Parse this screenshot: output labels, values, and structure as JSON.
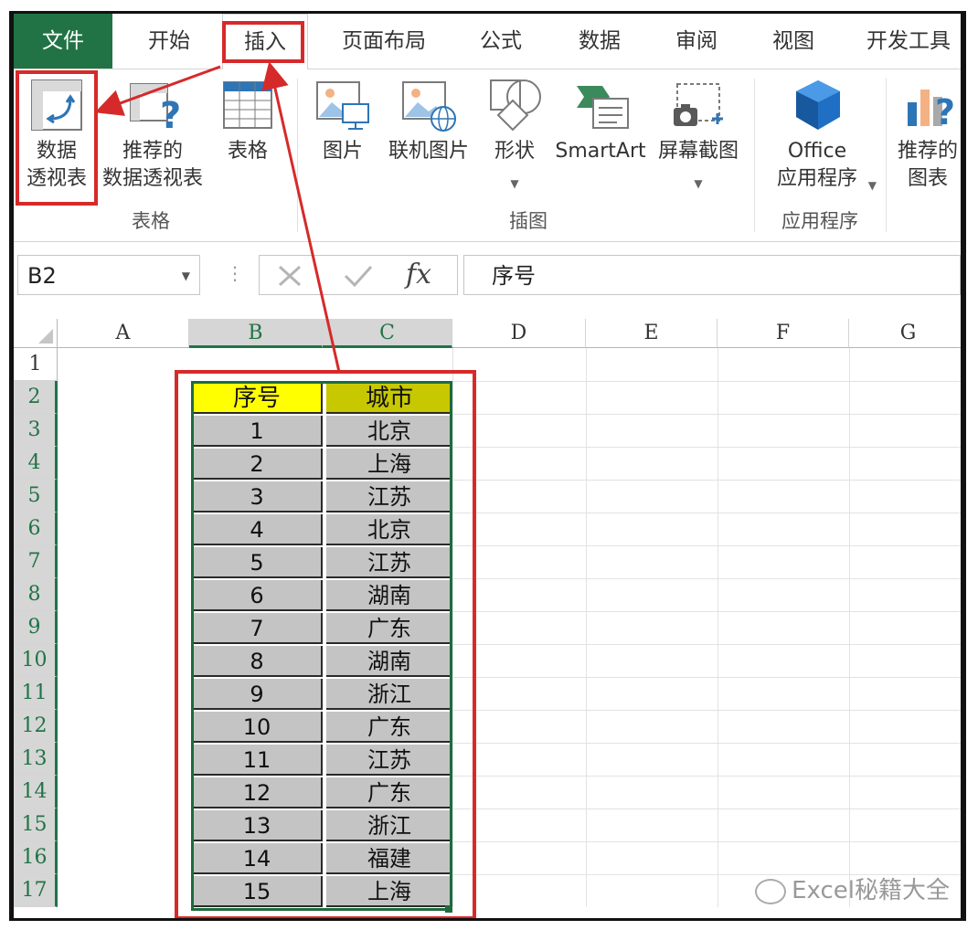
{
  "tabs": [
    "文件",
    "开始",
    "插入",
    "页面布局",
    "公式",
    "数据",
    "审阅",
    "视图",
    "开发工具"
  ],
  "ribbon": {
    "pivot_table": [
      "数据",
      "透视表"
    ],
    "recommended_pivot": [
      "推荐的",
      "数据透视表"
    ],
    "table": "表格",
    "picture": "图片",
    "online_picture": "联机图片",
    "shapes": "形状",
    "smartart": "SmartArt",
    "screenshot": "屏幕截图",
    "office_apps": [
      "Office",
      "应用程序"
    ],
    "recommended_charts": [
      "推荐的",
      "图表"
    ],
    "group_tables": "表格",
    "group_illustrations": "插图",
    "group_apps": "应用程序"
  },
  "formula_bar": {
    "name_box": "B2",
    "fx": "fx",
    "formula": "序号"
  },
  "columns": [
    "A",
    "B",
    "C",
    "D",
    "E",
    "F",
    "G"
  ],
  "rows": [
    "1",
    "2",
    "3",
    "4",
    "5",
    "6",
    "7",
    "8",
    "9",
    "10",
    "11",
    "12",
    "13",
    "14",
    "15",
    "16",
    "17"
  ],
  "table": {
    "headers": [
      "序号",
      "城市"
    ],
    "rows": [
      [
        "1",
        "北京"
      ],
      [
        "2",
        "上海"
      ],
      [
        "3",
        "江苏"
      ],
      [
        "4",
        "北京"
      ],
      [
        "5",
        "江苏"
      ],
      [
        "6",
        "湖南"
      ],
      [
        "7",
        "广东"
      ],
      [
        "8",
        "湖南"
      ],
      [
        "9",
        "浙江"
      ],
      [
        "10",
        "广东"
      ],
      [
        "11",
        "江苏"
      ],
      [
        "12",
        "广东"
      ],
      [
        "13",
        "浙江"
      ],
      [
        "14",
        "福建"
      ],
      [
        "15",
        "上海"
      ]
    ]
  },
  "watermark": "Excel秘籍大全",
  "colors": {
    "excel_green": "#217346",
    "annotation_red": "#d62a2a",
    "header_yellow": "#ffff00"
  }
}
